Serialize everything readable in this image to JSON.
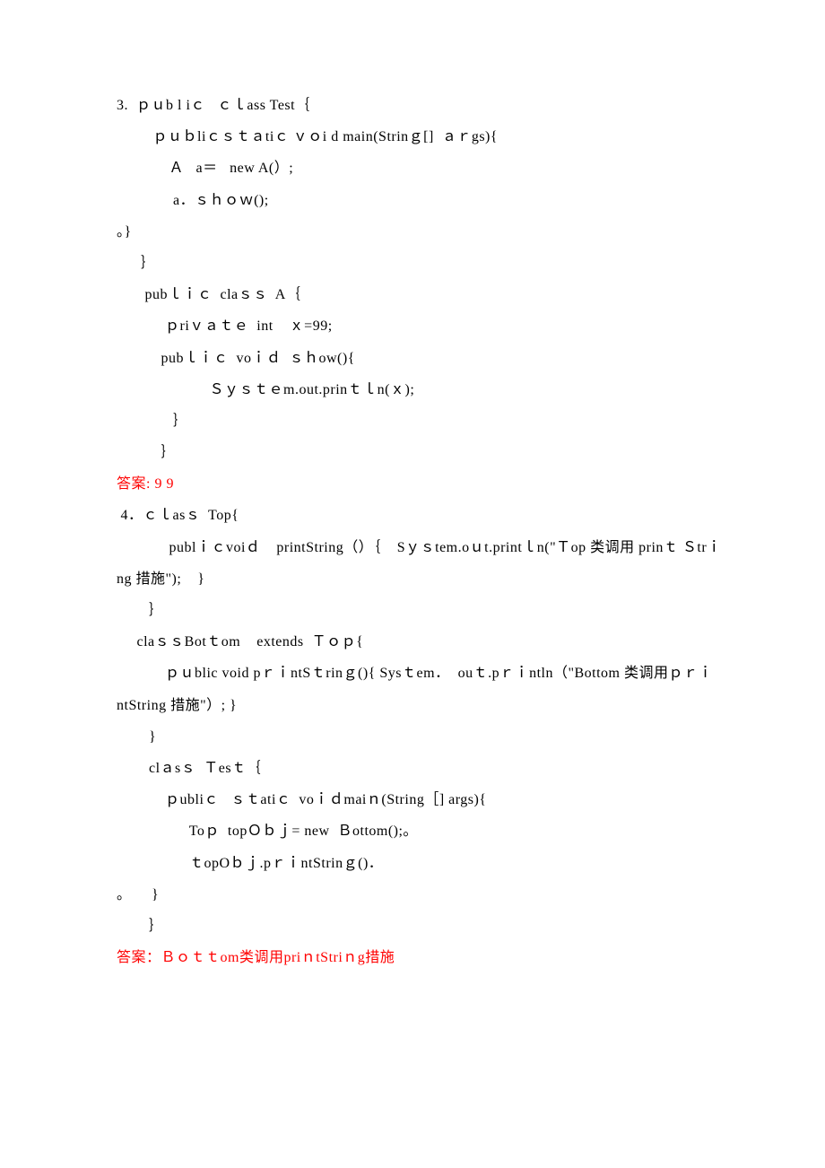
{
  "lines": [
    {
      "text": "3.  ｐｕb l iｃ   ｃｌass Test｛",
      "cls": "line"
    },
    {
      "text": "         ｐｕｂliｃｓｔａtiｃ ｖｏi d main(Strinｇ[]  ａｒgs){",
      "cls": "line"
    },
    {
      "text": "             Ａ   a＝   new A(）;",
      "cls": "line"
    },
    {
      "text": "              a．ｓｈｏｗ();",
      "cls": "line"
    },
    {
      "text": "。}",
      "cls": "line"
    },
    {
      "text": "      ｝",
      "cls": "line"
    },
    {
      "text": "       pubｌｉｃ  claｓｓ  A｛",
      "cls": "line"
    },
    {
      "text": "            ｐriｖａｔｅ  int    ｘ=99;",
      "cls": "line"
    },
    {
      "text": "           pubｌｉｃ  voｉｄ  ｓｈow(){",
      "cls": "line"
    },
    {
      "text": "                       Ｓｙｓｔｅm.out.prinｔｌn(ｘ);",
      "cls": "line"
    },
    {
      "text": "              ｝",
      "cls": "line"
    },
    {
      "text": "           ｝",
      "cls": "line"
    },
    {
      "text": "答案: 9 9",
      "cls": "line answer"
    },
    {
      "text": " 4．ｃｌasｓ  Top{",
      "cls": "line"
    },
    {
      "text": "             publｉｃvoiｄ    printString（）｛    Sｙｓtem.oｕt.printｌn(\"Ｔop 类调用 prinｔ Ｓtrｉ",
      "cls": "line"
    },
    {
      "text": "ng 措施\");    }",
      "cls": "line"
    },
    {
      "text": "        ｝",
      "cls": "line"
    },
    {
      "text": "     claｓｓBotｔom    extends  Ｔｏｐ{",
      "cls": "line"
    },
    {
      "text": "            ｐｕblic void pｒｉntSｔrinｇ(){ Sysｔem．  ouｔ.pｒｉntln（\"Bottom 类调用ｐｒｉ",
      "cls": "line"
    },
    {
      "text": "ntString 措施\"）; }",
      "cls": "line"
    },
    {
      "text": "        }",
      "cls": "line"
    },
    {
      "text": "        clａsｓ  Ｔesｔ｛",
      "cls": "line"
    },
    {
      "text": "            ｐubliｃ   ｓｔatiｃ  voｉｄmaiｎ(String［] args){",
      "cls": "line"
    },
    {
      "text": "                  Toｐ  topＯｂｊ= new  Ｂottom();。",
      "cls": "line"
    },
    {
      "text": "                  ｔopOｂｊ.pｒｉntStrinｇ()．",
      "cls": "line"
    },
    {
      "text": "。     }",
      "cls": "line"
    },
    {
      "text": "        ｝",
      "cls": "line"
    },
    {
      "text": "答案：Ｂｏｔｔom类调用priｎtStriｎg措施",
      "cls": "line answer"
    }
  ]
}
